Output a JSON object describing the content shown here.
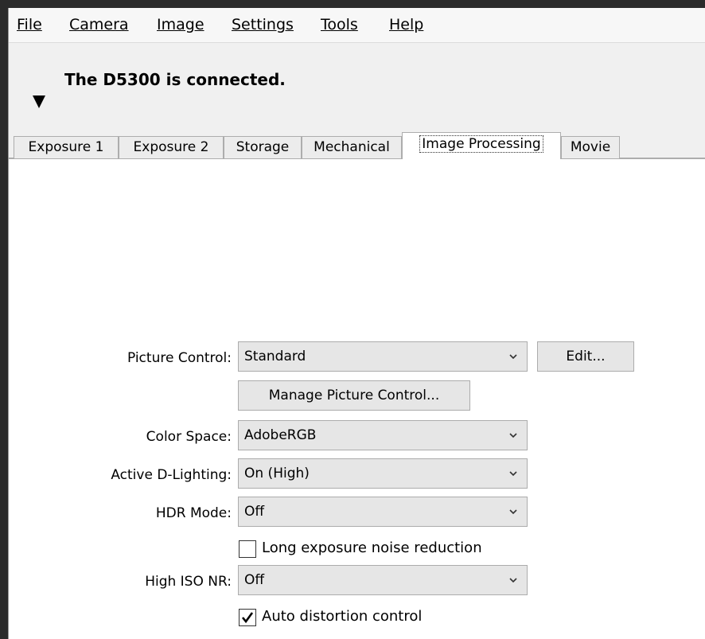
{
  "menu": [
    "File",
    "Camera",
    "Image",
    "Settings",
    "Tools",
    "Help"
  ],
  "status": "The D5300 is connected.",
  "tabs": [
    "Exposure 1",
    "Exposure 2",
    "Storage",
    "Mechanical",
    "Image Processing",
    "Movie"
  ],
  "active_tab": "Image Processing",
  "picture_control": {
    "label": "Picture Control:",
    "value": "Standard",
    "edit_label": "Edit..."
  },
  "manage_label": "Manage Picture Control...",
  "color_space": {
    "label": "Color Space:",
    "value": "AdobeRGB"
  },
  "active_dlighting": {
    "label": "Active D-Lighting:",
    "value": "On (High)"
  },
  "hdr_mode": {
    "label": "HDR Mode:",
    "value": "Off"
  },
  "long_exposure_nr": {
    "label": "Long exposure noise reduction",
    "checked": false
  },
  "high_iso_nr": {
    "label": "High ISO NR:",
    "value": "Off"
  },
  "auto_distortion": {
    "label": "Auto distortion control",
    "checked": true
  },
  "icons": {
    "collapse": "triangle-down-icon",
    "dropdown": "chevron-down-icon",
    "check": "checkmark-icon"
  }
}
